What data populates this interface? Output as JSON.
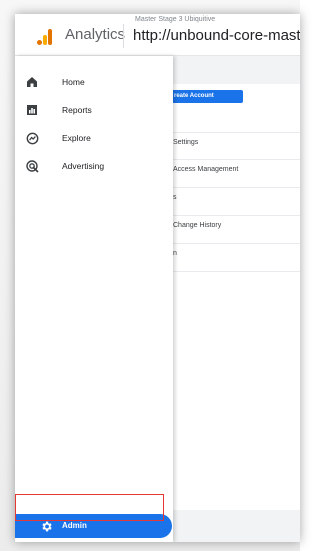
{
  "header": {
    "app_title": "Analytics",
    "account_path": "Master Stage 3 Ubiquitive",
    "property_url": "http://unbound-core-mast"
  },
  "main": {
    "create_account_label": "reate Account",
    "rows": [
      "Settings",
      "Access Management",
      "s",
      "Change History",
      "n"
    ]
  },
  "nav": {
    "items": [
      {
        "label": "Home",
        "icon": "home-icon"
      },
      {
        "label": "Reports",
        "icon": "reports-icon"
      },
      {
        "label": "Explore",
        "icon": "explore-icon"
      },
      {
        "label": "Advertising",
        "icon": "advertising-icon"
      }
    ],
    "admin": {
      "label": "Admin",
      "icon": "gear-icon"
    }
  },
  "colors": {
    "accent": "#1a73e8",
    "logo_orange": "#e37400",
    "logo_yellow": "#f9ab00",
    "highlight": "#e53935"
  }
}
